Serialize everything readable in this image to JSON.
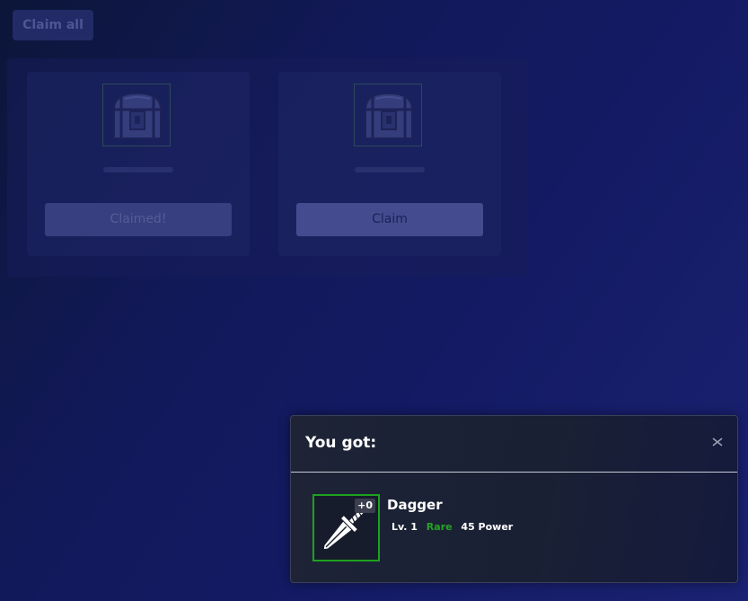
{
  "toolbar": {
    "claim_all_label": "Claim all"
  },
  "rewards": [
    {
      "icon": "chest-icon",
      "button_label": "Claimed!",
      "state": "claimed"
    },
    {
      "icon": "chest-icon",
      "button_label": "Claim",
      "state": "available"
    }
  ],
  "popup": {
    "title": "You got:",
    "close_icon": "close-icon",
    "item": {
      "name": "Dagger",
      "icon": "dagger-icon",
      "upgrade": "+0",
      "level": "Lv. 1",
      "rarity": "Rare",
      "power": "45 Power"
    }
  },
  "colors": {
    "rarity_rare": "#27a127",
    "popup_background": "#1e2436",
    "page_background": "#12195a"
  }
}
